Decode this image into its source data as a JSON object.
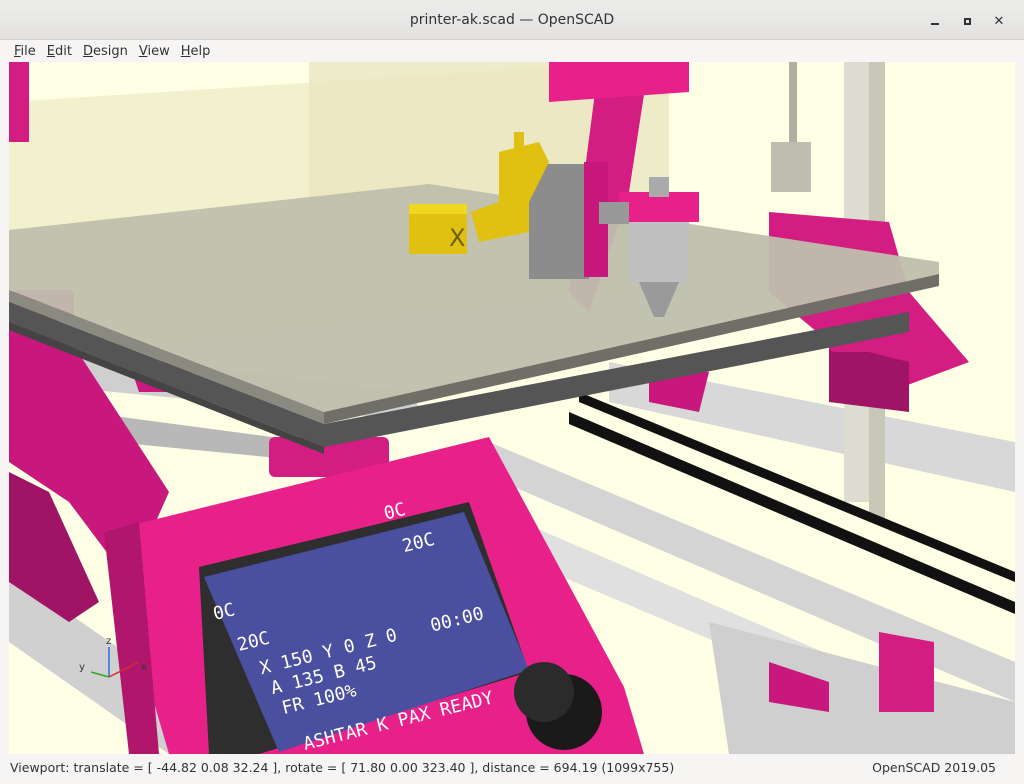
{
  "window": {
    "title": "printer-ak.scad — OpenSCAD"
  },
  "menubar": {
    "items": [
      {
        "label": "File",
        "accel": "F",
        "rest": "ile"
      },
      {
        "label": "Edit",
        "accel": "E",
        "rest": "dit"
      },
      {
        "label": "Design",
        "accel": "D",
        "rest": "esign"
      },
      {
        "label": "View",
        "accel": "V",
        "rest": "iew"
      },
      {
        "label": "Help",
        "accel": "H",
        "rest": "elp"
      }
    ]
  },
  "viewport": {
    "background": "#ffffe5",
    "model_color": "#e8218a",
    "lcd": {
      "bed_temp": "0C",
      "bed_target": "20C",
      "hotend_temp": "0C",
      "hotend_target": "20C",
      "line_xyz": "X 150  Y 0  Z 0",
      "line_ab": "A 135 B 45",
      "time": "00:00",
      "feedrate": "FR 100%",
      "status": "ASHTAR K PAX READY"
    },
    "part_x_label": "X",
    "axes": {
      "z": "z",
      "y": "y",
      "x": "x"
    }
  },
  "statusbar": {
    "viewport_info": "Viewport: translate = [ -44.82 0.08 32.24 ], rotate = [ 71.80 0.00 323.40 ], distance = 694.19 (1099x755)",
    "version": "OpenSCAD 2019.05"
  }
}
